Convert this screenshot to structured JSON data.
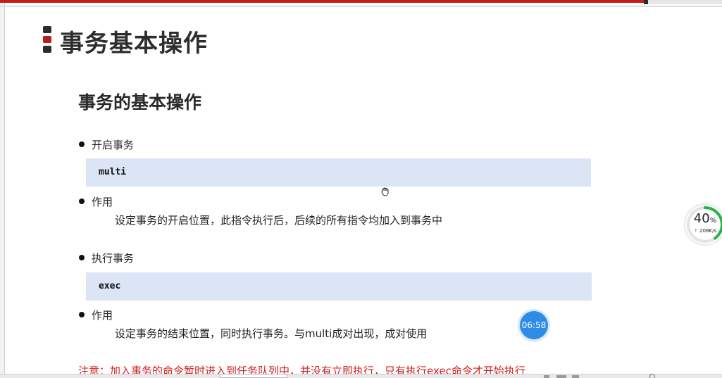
{
  "slide": {
    "title": "事务基本操作",
    "section_heading": "事务的基本操作",
    "bullets": [
      {
        "label": "开启事务",
        "code": "multi"
      },
      {
        "label": "作用",
        "description": "设定事务的开启位置，此指令执行后，后续的所有指令均加入到事务中"
      },
      {
        "label": "执行事务",
        "code": "exec"
      },
      {
        "label": "作用",
        "description": "设定事务的结束位置，同时执行事务。与multi成对出现，成对使用"
      }
    ],
    "note": "注意：加入事务的命令暂时进入到任务队列中，并没有立即执行，只有执行exec命令才开始执行"
  },
  "speed_widget": {
    "percent": "40",
    "percent_unit": "%",
    "rate": "208K/s",
    "ring_fraction": 0.4,
    "ring_color": "#2bb24c"
  },
  "timer_badge": {
    "time": "06:58"
  },
  "colors": {
    "accent_red": "#c41b1b",
    "code_background": "#dbe5f5",
    "note_red": "#d01f1f",
    "timer_blue": "#2f8ce6"
  },
  "icons": {
    "title_marker": "stacked-squares-icon",
    "cursor": "hand-grab-cursor-icon",
    "upload_arrow": "arrow-up-icon"
  }
}
